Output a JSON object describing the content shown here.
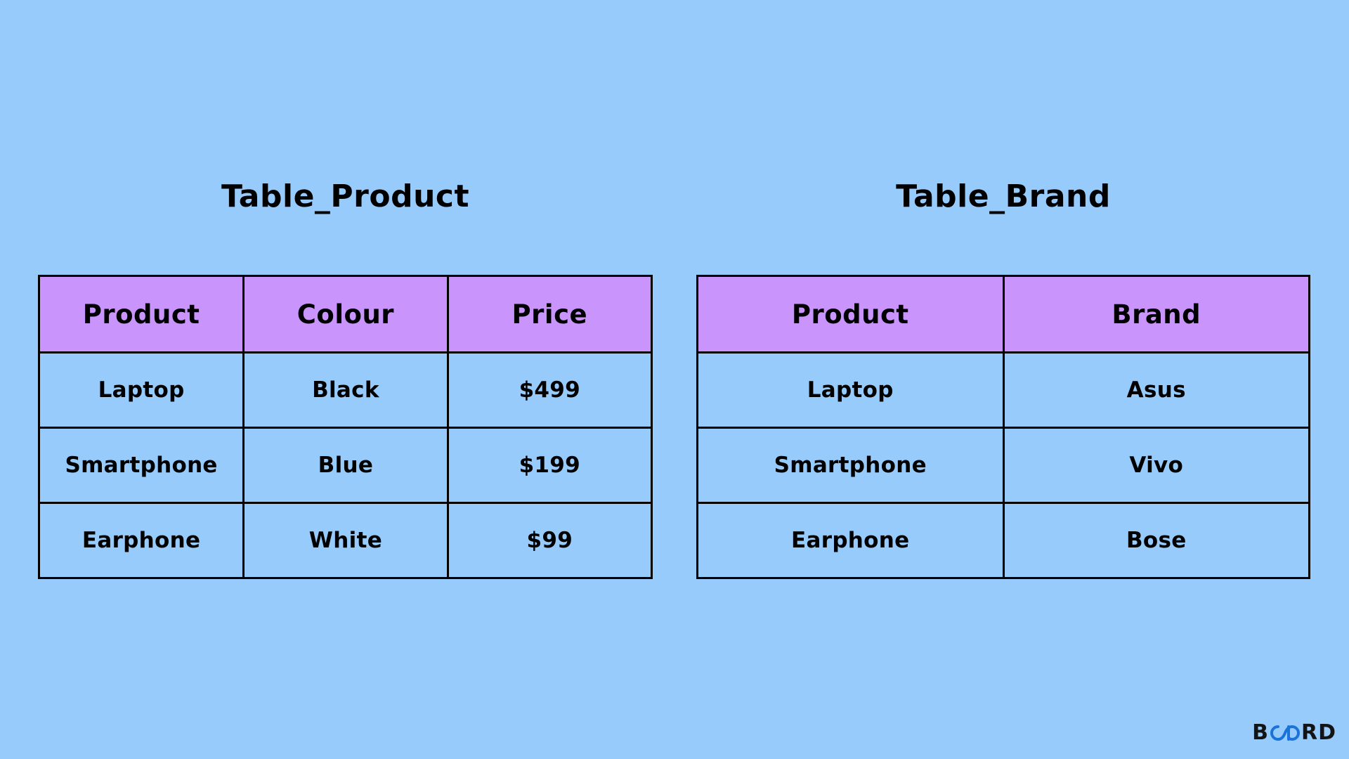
{
  "tables": [
    {
      "title": "Table_Product",
      "headers": [
        "Product",
        "Colour",
        "Price"
      ],
      "rows": [
        [
          "Laptop",
          "Black",
          "$499"
        ],
        [
          "Smartphone",
          "Blue",
          "$199"
        ],
        [
          "Earphone",
          "White",
          "$99"
        ]
      ]
    },
    {
      "title": "Table_Brand",
      "headers": [
        "Product",
        "Brand"
      ],
      "rows": [
        [
          "Laptop",
          "Asus"
        ],
        [
          "Smartphone",
          "Vivo"
        ],
        [
          "Earphone",
          "Bose"
        ]
      ]
    }
  ],
  "logo": {
    "prefix": "B",
    "suffix": "RD",
    "icon": "infinity-oo-icon",
    "accent_color": "#1a73d9"
  },
  "colors": {
    "background": "#96cbfc",
    "header": "#c994fb",
    "border": "#000000"
  }
}
